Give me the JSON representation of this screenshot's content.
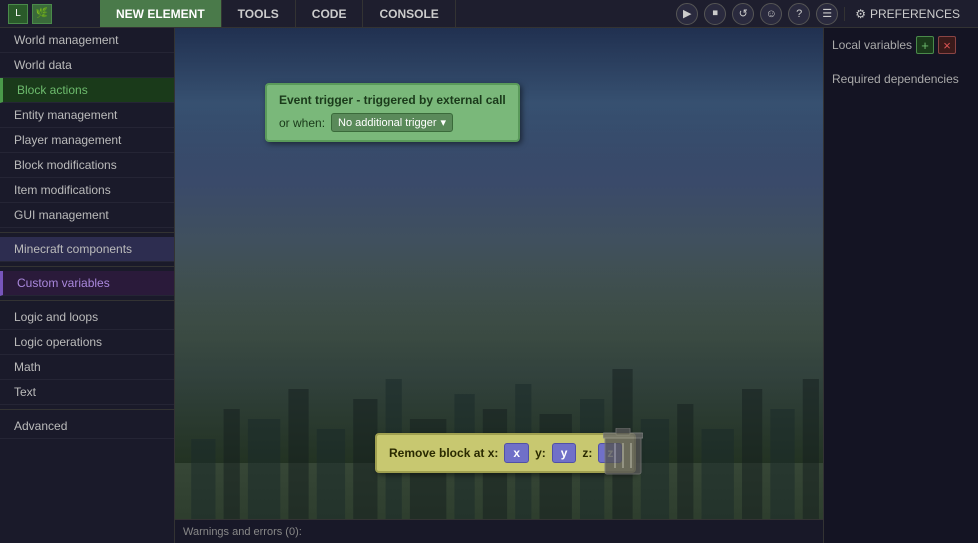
{
  "topbar": {
    "logo_text": "L",
    "tabs": [
      {
        "id": "new-element",
        "label": "NEW ELEMENT",
        "active": true
      },
      {
        "id": "tools",
        "label": "TOOLS",
        "active": false
      },
      {
        "id": "code",
        "label": "CODE",
        "active": false
      },
      {
        "id": "console",
        "label": "CONSOLE",
        "active": false
      }
    ],
    "icons": [
      "▶",
      "⏹",
      "↺",
      "☺",
      "?",
      "☰"
    ],
    "preferences_label": "PREFERENCES"
  },
  "sidebar": {
    "items": [
      {
        "id": "world-management",
        "label": "World management",
        "style": "normal"
      },
      {
        "id": "world-data",
        "label": "World data",
        "style": "normal"
      },
      {
        "id": "block-actions",
        "label": "Block actions",
        "style": "active-green"
      },
      {
        "id": "entity-management",
        "label": "Entity management",
        "style": "normal"
      },
      {
        "id": "player-management",
        "label": "Player management",
        "style": "normal"
      },
      {
        "id": "block-modifications",
        "label": "Block modifications",
        "style": "normal"
      },
      {
        "id": "item-modifications",
        "label": "Item modifications",
        "style": "normal"
      },
      {
        "id": "gui-management",
        "label": "GUI management",
        "style": "normal"
      },
      {
        "id": "separator1",
        "label": "",
        "style": "separator"
      },
      {
        "id": "minecraft-components",
        "label": "Minecraft components",
        "style": "highlighted"
      },
      {
        "id": "separator2",
        "label": "",
        "style": "separator"
      },
      {
        "id": "custom-variables",
        "label": "Custom variables",
        "style": "active-purple"
      },
      {
        "id": "separator3",
        "label": "",
        "style": "separator"
      },
      {
        "id": "logic-and-loops",
        "label": "Logic and loops",
        "style": "normal"
      },
      {
        "id": "logic-operations",
        "label": "Logic operations",
        "style": "normal"
      },
      {
        "id": "math",
        "label": "Math",
        "style": "normal"
      },
      {
        "id": "text",
        "label": "Text",
        "style": "normal"
      },
      {
        "id": "separator4",
        "label": "",
        "style": "separator"
      },
      {
        "id": "advanced",
        "label": "Advanced",
        "style": "normal"
      }
    ]
  },
  "right_panel": {
    "local_variables_label": "Local variables",
    "add_btn": "+",
    "remove_btn": "×",
    "required_dependencies_label": "Required dependencies"
  },
  "event_trigger": {
    "title": "Event trigger - triggered by external call",
    "or_when_label": "or when:",
    "dropdown_text": "No additional trigger",
    "dropdown_arrow": "▾"
  },
  "remove_block": {
    "label": "Remove block at x:",
    "x_value": "x",
    "y_label": "y:",
    "y_value": "y",
    "z_label": "z:",
    "z_value": "z"
  },
  "warnings_bar": {
    "text": "Warnings and errors (0):"
  },
  "colors": {
    "accent_green": "#4a9a4a",
    "accent_purple": "#7755bb",
    "coord_pill": "#7070c8"
  }
}
